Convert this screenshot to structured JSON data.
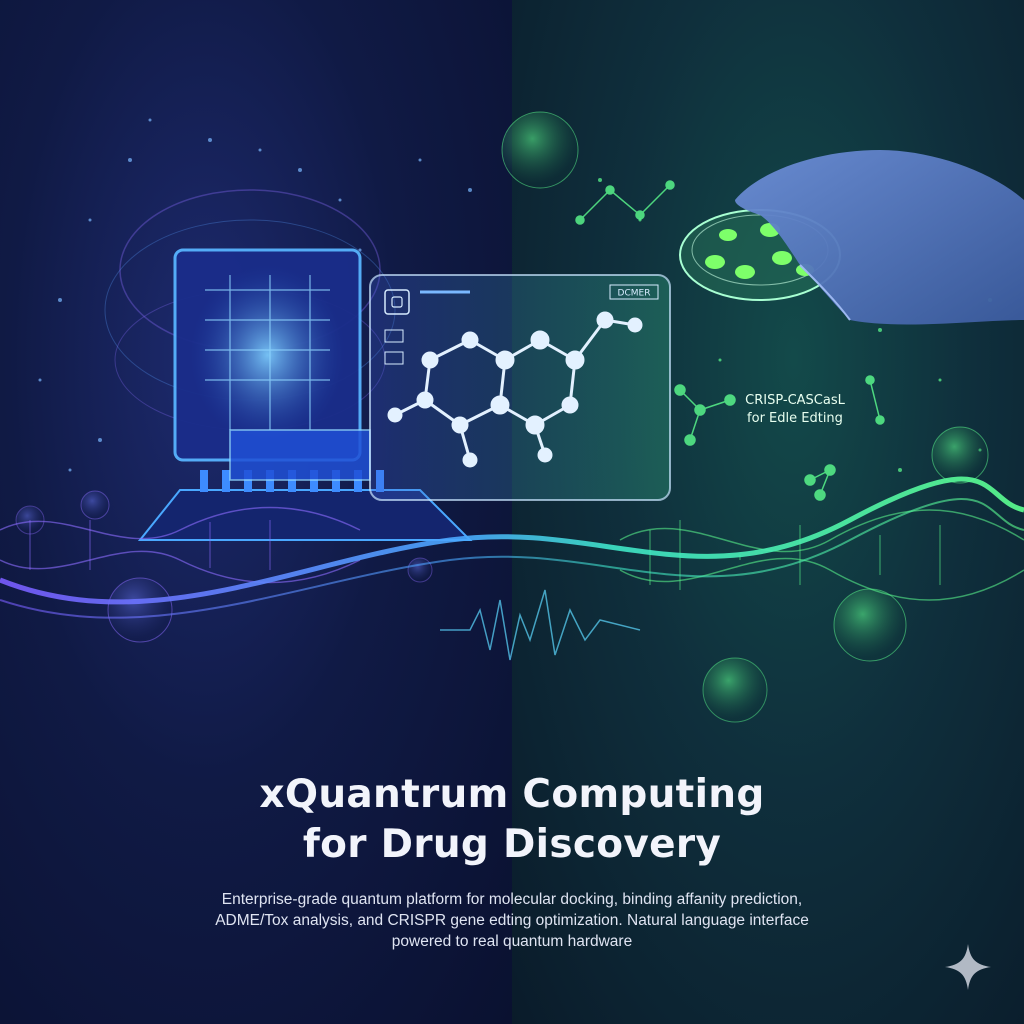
{
  "title": {
    "line1": "xQuantrum Computing",
    "line2": "for Drug Discovery"
  },
  "subtitle": {
    "line1": "Enterprise-grade quantum platform for molecular docking, binding affanity prediction,",
    "line2": "ADME/Tox analysis, and CRISPR gene edting optimization. Natural language interface",
    "line3": "powered to real quantum hardware"
  },
  "panel": {
    "badge": "DCMER"
  },
  "crispr": {
    "line1": "CRISP-CASCasL",
    "line2": "for Edle Edting"
  },
  "colors": {
    "left_accent": "#4aa8ff",
    "violet_accent": "#a46cff",
    "right_accent": "#5dff8f",
    "title_text": "#f2f4fb"
  },
  "icons": [
    "quantum-chip-icon",
    "molecule-icon",
    "dna-helix-icon",
    "petri-dish-icon",
    "gloved-hand-icon",
    "sparkle-icon"
  ]
}
